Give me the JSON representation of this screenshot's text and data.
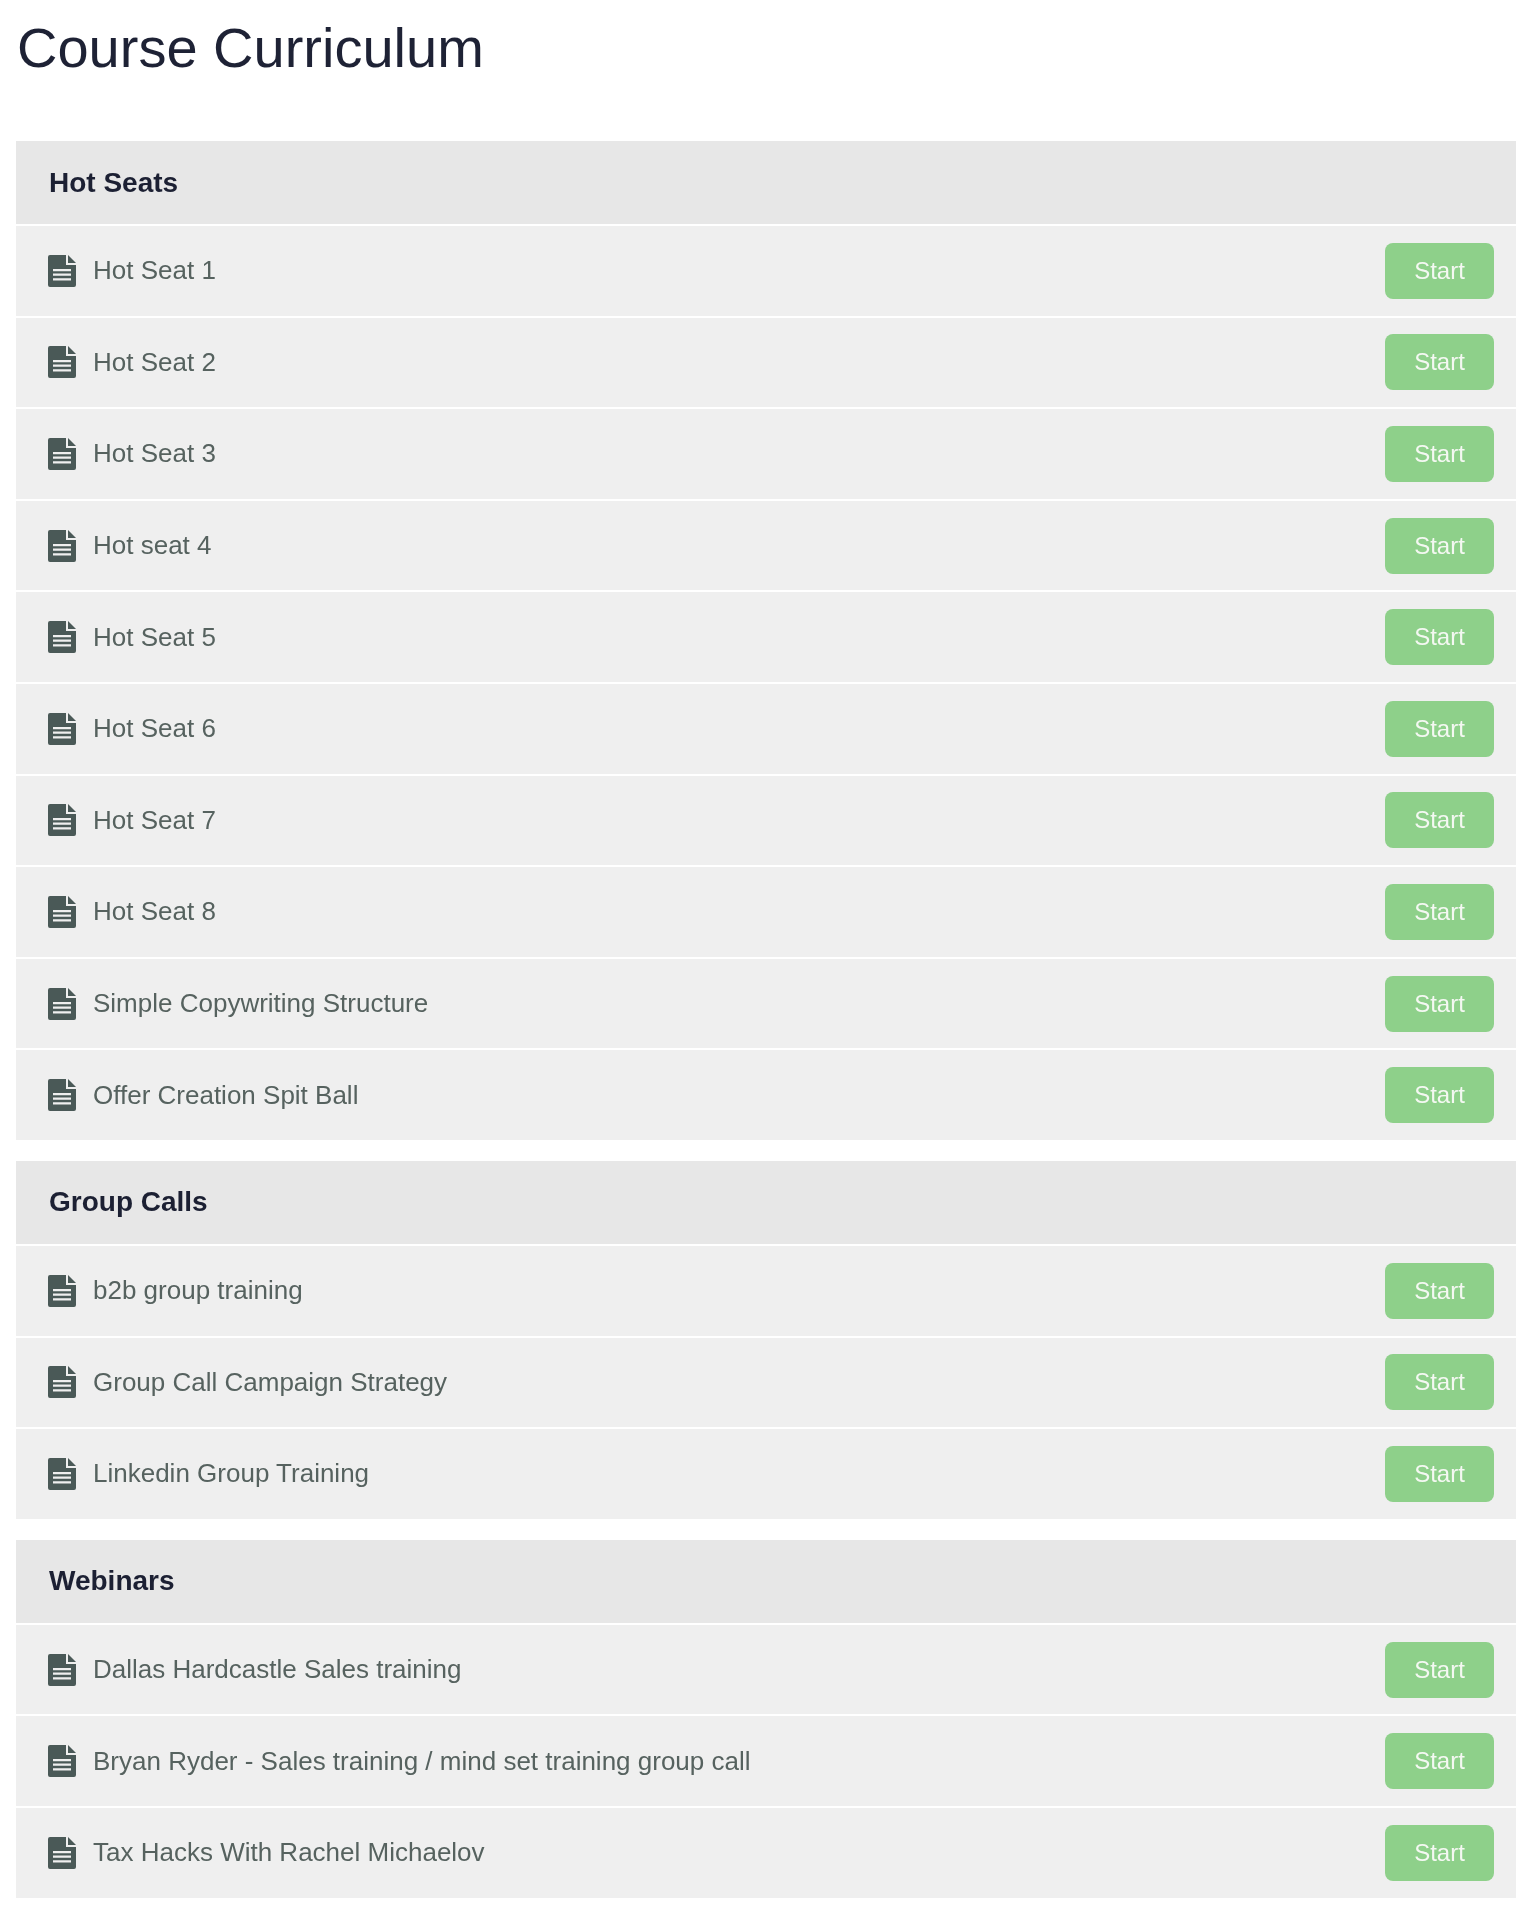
{
  "title": "Course Curriculum",
  "sections": [
    {
      "title": "Hot Seats",
      "lessons": [
        {
          "title": "Hot Seat 1",
          "button": "Start"
        },
        {
          "title": "Hot Seat 2",
          "button": "Start"
        },
        {
          "title": "Hot Seat 3",
          "button": "Start"
        },
        {
          "title": "Hot seat 4",
          "button": "Start"
        },
        {
          "title": "Hot Seat 5",
          "button": "Start"
        },
        {
          "title": "Hot Seat 6",
          "button": "Start"
        },
        {
          "title": "Hot Seat 7",
          "button": "Start"
        },
        {
          "title": "Hot Seat 8",
          "button": "Start"
        },
        {
          "title": "Simple Copywriting Structure",
          "button": "Start"
        },
        {
          "title": "Offer Creation Spit Ball",
          "button": "Start"
        }
      ]
    },
    {
      "title": "Group Calls",
      "lessons": [
        {
          "title": "b2b group training",
          "button": "Start"
        },
        {
          "title": "Group Call Campaign Strategy",
          "button": "Start"
        },
        {
          "title": "Linkedin Group Training",
          "button": "Start"
        }
      ]
    },
    {
      "title": "Webinars",
      "lessons": [
        {
          "title": "Dallas Hardcastle Sales training",
          "button": "Start"
        },
        {
          "title": "Bryan Ryder - Sales training / mind set training group call",
          "button": "Start"
        },
        {
          "title": "Tax Hacks With Rachel Michaelov",
          "button": "Start"
        }
      ]
    }
  ]
}
